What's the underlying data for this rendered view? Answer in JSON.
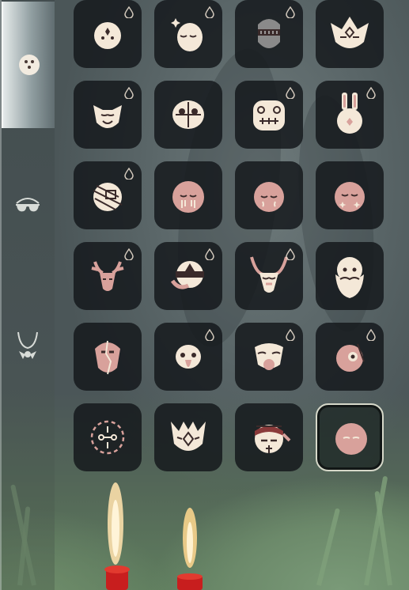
{
  "sidebar": {
    "tabs": [
      {
        "name": "masks-tab",
        "icon": "mask-icon",
        "active": true
      },
      {
        "name": "glasses-tab",
        "icon": "glasses-icon",
        "active": false
      },
      {
        "name": "necklace-tab",
        "icon": "necklace-icon",
        "active": false
      }
    ]
  },
  "grid": {
    "columns": 4,
    "items": [
      {
        "icon": "round-mask-icon",
        "drop": true,
        "selected": false
      },
      {
        "icon": "sleeping-mask-icon",
        "drop": true,
        "selected": false
      },
      {
        "icon": "stitched-mask-icon",
        "drop": true,
        "selected": false
      },
      {
        "icon": "crowned-fox-mask-icon",
        "drop": false,
        "selected": false
      },
      {
        "icon": "horned-mask-icon",
        "drop": true,
        "selected": false
      },
      {
        "icon": "bone-skull-mask-icon",
        "drop": false,
        "selected": false
      },
      {
        "icon": "ornate-lion-mask-icon",
        "drop": true,
        "selected": false
      },
      {
        "icon": "rabbit-mask-icon",
        "drop": true,
        "selected": false
      },
      {
        "icon": "bandaged-mask-icon",
        "drop": true,
        "selected": false
      },
      {
        "icon": "painted-tears-mask-icon",
        "drop": false,
        "selected": false
      },
      {
        "icon": "closed-eyes-mask-icon",
        "drop": false,
        "selected": false
      },
      {
        "icon": "star-cheek-mask-icon",
        "drop": false,
        "selected": false
      },
      {
        "icon": "antler-mask-icon",
        "drop": true,
        "selected": false
      },
      {
        "icon": "triangle-band-mask-icon",
        "drop": true,
        "selected": false
      },
      {
        "icon": "long-horn-mask-icon",
        "drop": true,
        "selected": false
      },
      {
        "icon": "bearded-elder-mask-icon",
        "drop": false,
        "selected": false
      },
      {
        "icon": "cracked-mask-icon",
        "drop": false,
        "selected": false
      },
      {
        "icon": "bird-beak-mask-icon",
        "drop": true,
        "selected": false
      },
      {
        "icon": "owl-beak-mask-icon",
        "drop": true,
        "selected": false
      },
      {
        "icon": "one-eye-mask-icon",
        "drop": true,
        "selected": false
      },
      {
        "icon": "dashed-circle-mask-icon",
        "drop": false,
        "selected": false
      },
      {
        "icon": "wolf-mask-icon",
        "drop": false,
        "selected": false
      },
      {
        "icon": "headband-mask-icon",
        "drop": false,
        "selected": false
      },
      {
        "icon": "pink-calm-mask-icon",
        "drop": false,
        "selected": true
      }
    ]
  },
  "colors": {
    "mask_cream": "#f4e8d8",
    "mask_pink": "#d8a19b",
    "mask_line": "#3a2a2a",
    "slot_bg": "#15191d"
  }
}
